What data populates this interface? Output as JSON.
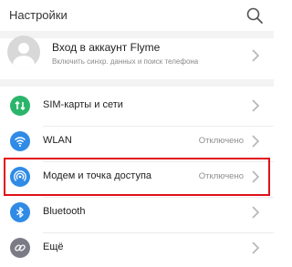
{
  "header": {
    "title": "Настройки",
    "search_icon": "search-icon"
  },
  "account": {
    "title": "Вход в аккаунт Flyme",
    "subtitle": "Включить синхр. данных и поиск телефона"
  },
  "settings": [
    {
      "label": "SIM-карты и сети",
      "status": "",
      "icon": "sim-card-icon",
      "color": "#2bb56b"
    },
    {
      "label": "WLAN",
      "status": "Отключено",
      "icon": "wifi-icon",
      "color": "#2f8be6"
    },
    {
      "label": "Модем и точка доступа",
      "status": "Отключено",
      "icon": "hotspot-icon",
      "color": "#2f8be6",
      "highlighted": true
    },
    {
      "label": "Bluetooth",
      "status": "",
      "icon": "bluetooth-icon",
      "color": "#2f8be6"
    },
    {
      "label": "Ещё",
      "status": "",
      "icon": "link-icon",
      "color": "#7b7b86"
    }
  ],
  "colors": {
    "highlight": "#e0101a",
    "chevron": "#b5b5b5"
  }
}
